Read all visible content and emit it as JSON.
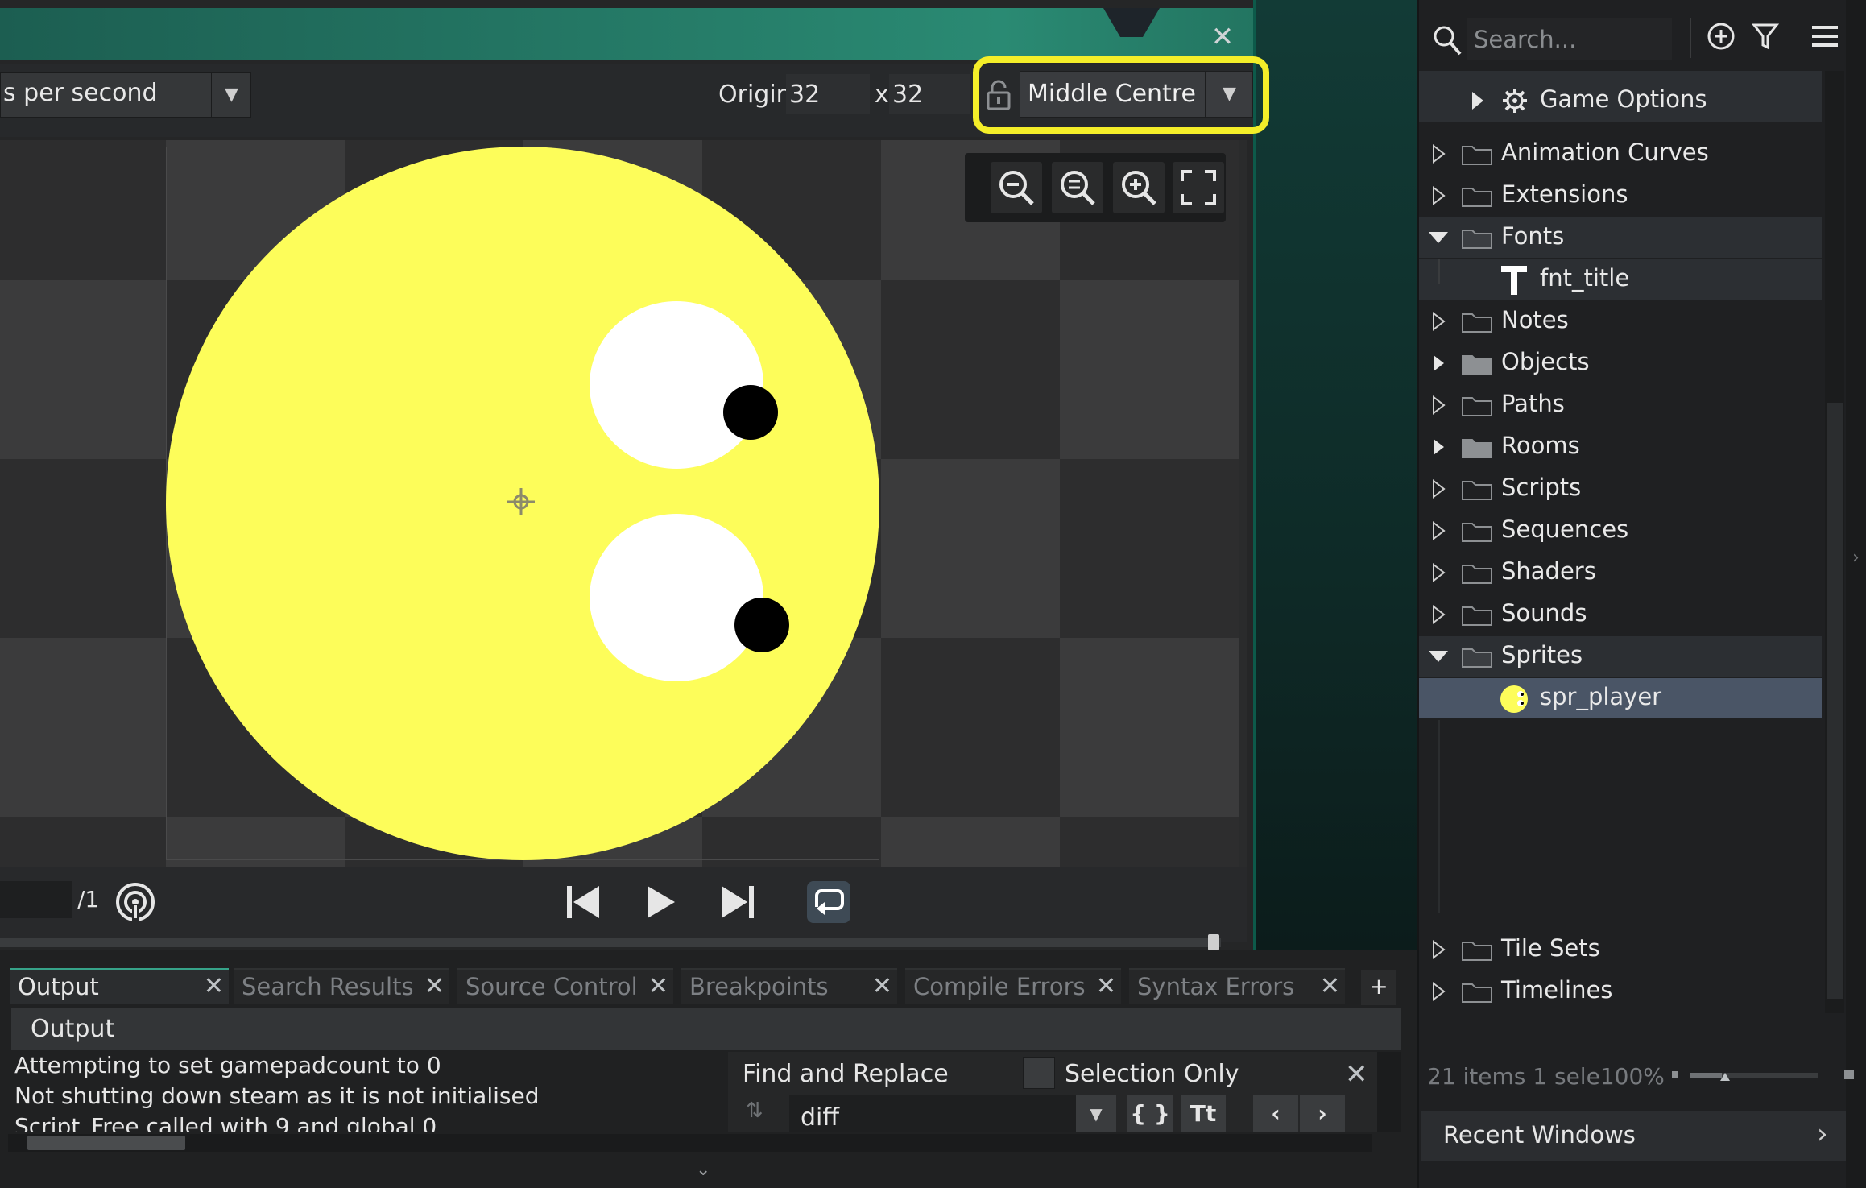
{
  "editor": {
    "speed_label": "s per second",
    "origin_label": "Origin",
    "origin_x": "32",
    "origin_sep": "x",
    "origin_y": "32",
    "origin_preset": "Middle Centre",
    "frame_total": "/1"
  },
  "output": {
    "tabs": [
      "Output",
      "Search Results",
      "Source Control",
      "Breakpoints",
      "Compile Errors",
      "Syntax Errors"
    ],
    "header": "Output",
    "lines": [
      "Attempting to set gamepadcount to 0",
      "Not shutting down steam as it is not initialised",
      "Script_Free called with 9 and global 0"
    ]
  },
  "find": {
    "title": "Find and Replace",
    "selection_only": "Selection Only",
    "value": "diff",
    "braces_label": "{ }",
    "case_label": "Tt"
  },
  "assets": {
    "search_placeholder": "Search...",
    "game_options": "Game Options",
    "items": [
      "Animation Curves",
      "Extensions",
      "Fonts",
      "fnt_title",
      "Notes",
      "Objects",
      "Paths",
      "Rooms",
      "Scripts",
      "Sequences",
      "Shaders",
      "Sounds",
      "Sprites",
      "spr_player",
      "Tile Sets",
      "Timelines"
    ],
    "status": "21 items    1 sele100%",
    "recent_windows": "Recent Windows"
  },
  "colors": {
    "sprite_yellow": "#fdfd5a",
    "highlight": "#f4ee29",
    "accent_teal": "#2a8a73",
    "selection": "#4a5566"
  }
}
